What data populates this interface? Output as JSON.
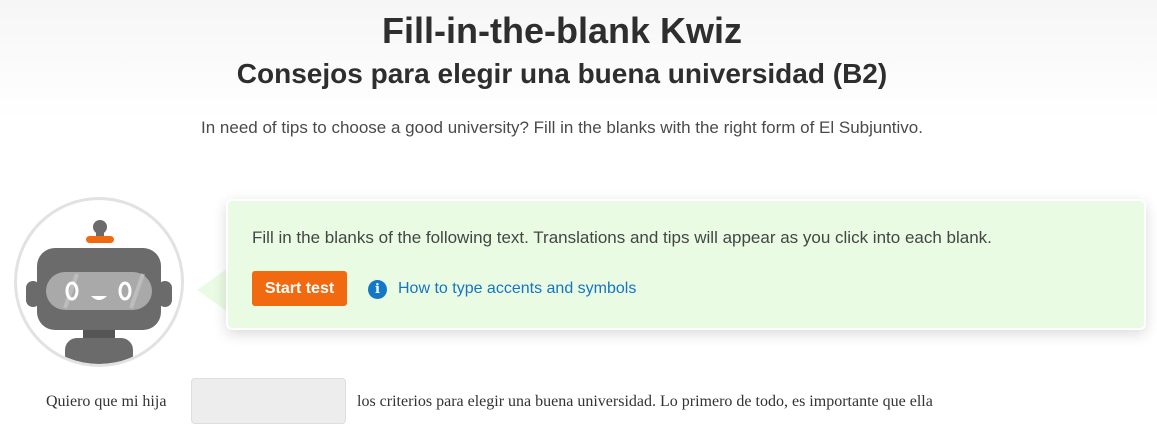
{
  "header": {
    "title": "Fill-in-the-blank Kwiz",
    "subtitle": "Consejos para elegir una buena universidad (B2)",
    "intro": "In need of tips to choose a good university? Fill in the blanks with the right form of El Subjuntivo."
  },
  "instructions": {
    "text": "Fill in the blanks of the following text. Translations and tips will appear as you click into each blank.",
    "start_button": "Start test",
    "info_icon_glyph": "i",
    "accents_link": "How to type accents and symbols"
  },
  "exercise": {
    "before_blank": "Quiero que mi hija",
    "blank_value": "",
    "after_blank": "los criterios para elegir una buena universidad.  Lo primero de todo, es importante que ella"
  },
  "colors": {
    "accent": "#f26a10",
    "card_background": "#eafbe4",
    "link": "#1575c2",
    "robot_body": "#6b6b6b",
    "robot_antenna": "#f26a10"
  },
  "icons": {
    "robot": "robot-mascot-icon",
    "info": "info-icon"
  }
}
